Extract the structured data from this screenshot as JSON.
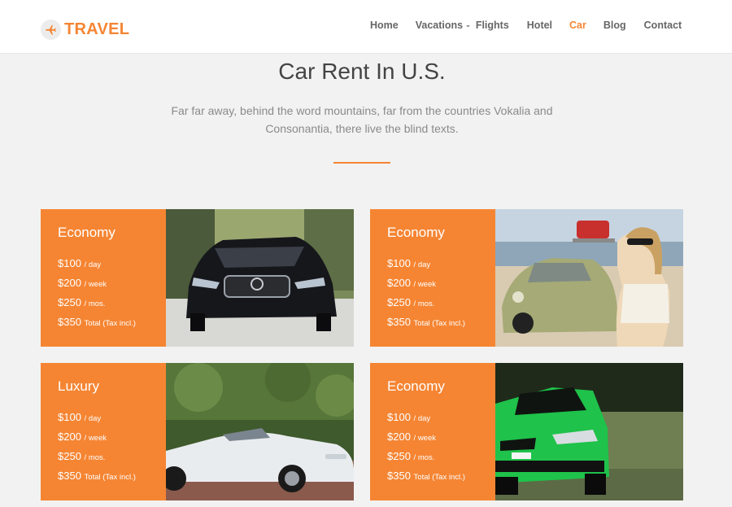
{
  "brand": {
    "name": "TRAVEL",
    "icon": "airplane-icon"
  },
  "nav": {
    "items": [
      {
        "label": "Home",
        "active": false
      },
      {
        "label": "Vacations",
        "active": false,
        "dropdown": true
      },
      {
        "label": "Flights",
        "active": false
      },
      {
        "label": "Hotel",
        "active": false
      },
      {
        "label": "Car",
        "active": true
      },
      {
        "label": "Blog",
        "active": false
      },
      {
        "label": "Contact",
        "active": false
      }
    ]
  },
  "intro": {
    "title": "Car Rent In U.S.",
    "subtitle": "Far far away, behind the word mountains, far from the countries Vokalia and Consonantia, there live the blind texts."
  },
  "cards": [
    {
      "type": "Economy",
      "photo": "black-sedan-photo",
      "prices": [
        {
          "amount": "$100",
          "unit": "/ day"
        },
        {
          "amount": "$200",
          "unit": "/ week"
        },
        {
          "amount": "$250",
          "unit": "/ mos."
        },
        {
          "amount": "$350",
          "unit": "Total (Tax incl.)"
        }
      ]
    },
    {
      "type": "Economy",
      "photo": "vintage-beetle-woman-photo",
      "prices": [
        {
          "amount": "$100",
          "unit": "/ day"
        },
        {
          "amount": "$200",
          "unit": "/ week"
        },
        {
          "amount": "$250",
          "unit": "/ mos."
        },
        {
          "amount": "$350",
          "unit": "Total (Tax incl.)"
        }
      ]
    },
    {
      "type": "Luxury",
      "photo": "white-convertible-photo",
      "prices": [
        {
          "amount": "$100",
          "unit": "/ day"
        },
        {
          "amount": "$200",
          "unit": "/ week"
        },
        {
          "amount": "$250",
          "unit": "/ mos."
        },
        {
          "amount": "$350",
          "unit": "Total (Tax incl.)"
        }
      ]
    },
    {
      "type": "Economy",
      "photo": "green-sports-car-photo",
      "prices": [
        {
          "amount": "$100",
          "unit": "/ day"
        },
        {
          "amount": "$200",
          "unit": "/ week"
        },
        {
          "amount": "$250",
          "unit": "/ mos."
        },
        {
          "amount": "$350",
          "unit": "Total (Tax incl.)"
        }
      ]
    }
  ],
  "colors": {
    "accent": "#f58533",
    "background": "#f2f2f2",
    "header": "#ffffff"
  }
}
